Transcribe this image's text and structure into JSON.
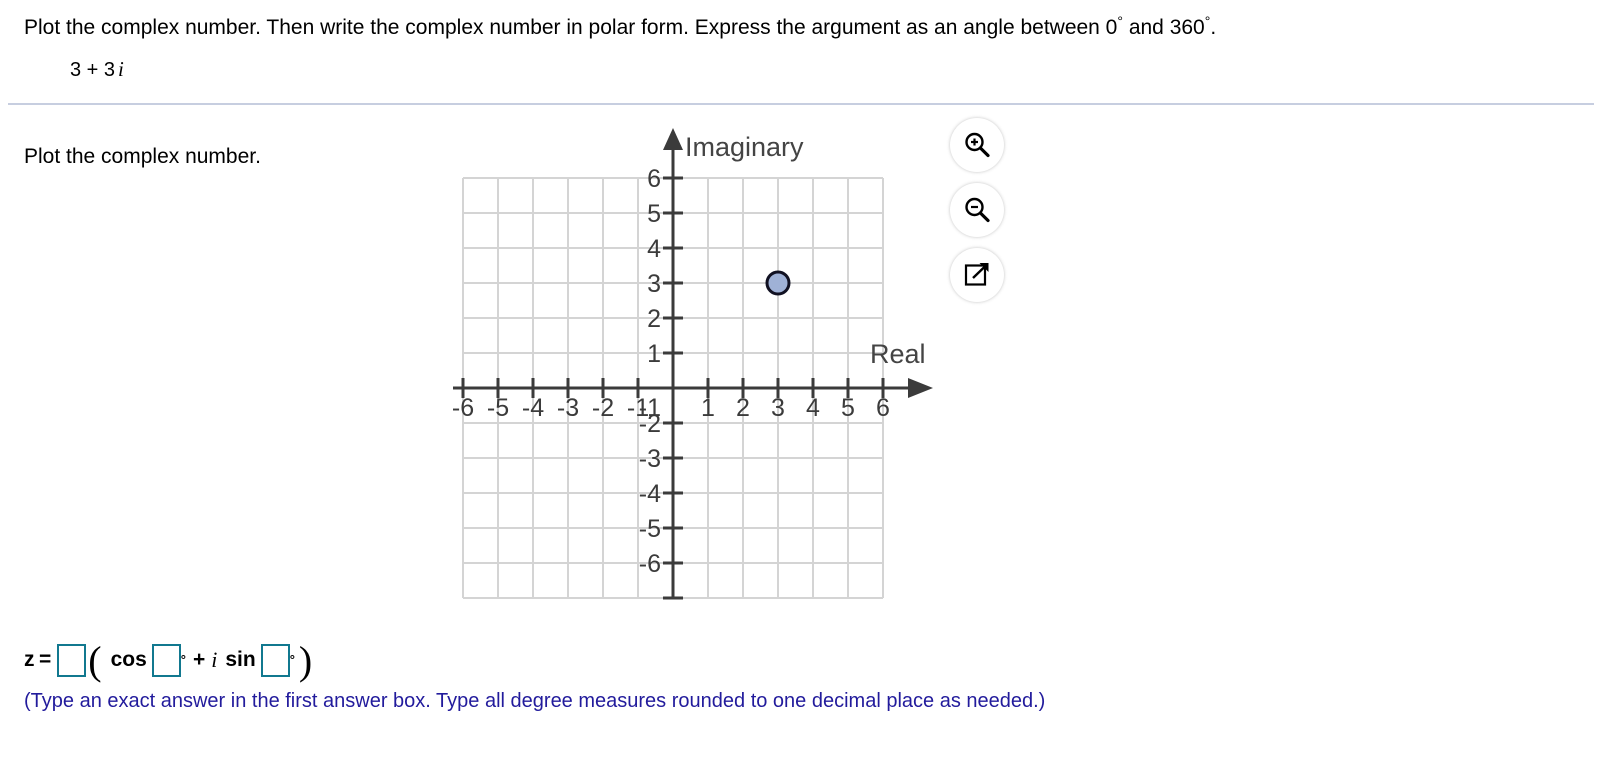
{
  "header": {
    "question_part1": "Plot the complex number.  Then write the complex number in polar form.  Express the argument as an angle between 0",
    "degree_symbol": "°",
    "question_mid": " and 360",
    "question_end": ".",
    "expression_real": "3 + 3",
    "expression_imaginary_unit": "i"
  },
  "body": {
    "plot_instruction": "Plot the complex number."
  },
  "graph": {
    "imaginary_axis_label": "Imaginary",
    "real_axis_label": "Real",
    "point_label": "plotted-point",
    "point_fill": "#9fb1d6",
    "point_stroke": "#111122",
    "grid_color": "#d4d4d4",
    "axis_color": "#3b3b3b",
    "tick_label_color": "#3b3b3b"
  },
  "chart_data": {
    "type": "scatter",
    "title": "",
    "xlabel": "Real",
    "ylabel": "Imaginary",
    "xlim": [
      -6,
      6
    ],
    "ylim": [
      -6,
      6
    ],
    "xticks": [
      -6,
      -5,
      -4,
      -3,
      -2,
      -1,
      1,
      2,
      3,
      4,
      5,
      6
    ],
    "yticks": [
      -6,
      -5,
      -4,
      -3,
      -2,
      -1,
      1,
      2,
      3,
      4,
      5,
      6
    ],
    "xtick_labels": [
      "-6",
      "-5",
      "-4",
      "-3",
      "-2",
      "-1",
      "1",
      "2",
      "3",
      "4",
      "5",
      "6"
    ],
    "ytick_labels": [
      "-6",
      "-5",
      "-4",
      "-3",
      "-2",
      "-1",
      "1",
      "2",
      "3",
      "4",
      "5",
      "6"
    ],
    "grid": true,
    "legend": "none",
    "series": [
      {
        "name": "complex number 3 + 3i",
        "points": [
          {
            "x": 3,
            "y": 3
          }
        ]
      }
    ]
  },
  "toolbar": {
    "buttons": [
      {
        "name": "zoom-in-icon",
        "label": "Zoom in"
      },
      {
        "name": "zoom-out-icon",
        "label": "Zoom out"
      },
      {
        "name": "expand-icon",
        "label": "Open in new window"
      }
    ]
  },
  "answer": {
    "z_label": "z",
    "equals": "=",
    "open_paren": "(",
    "close_paren": ")",
    "cos_label": "cos",
    "sin_label": "sin",
    "degree_symbol": "°",
    "plus_sign": "+",
    "i_symbol": "i",
    "box_modulus_value": "",
    "box_cos_value": "",
    "box_sin_value": "",
    "hint": "(Type an exact answer in the first answer box.  Type all degree measures rounded to one decimal place as needed.)"
  }
}
